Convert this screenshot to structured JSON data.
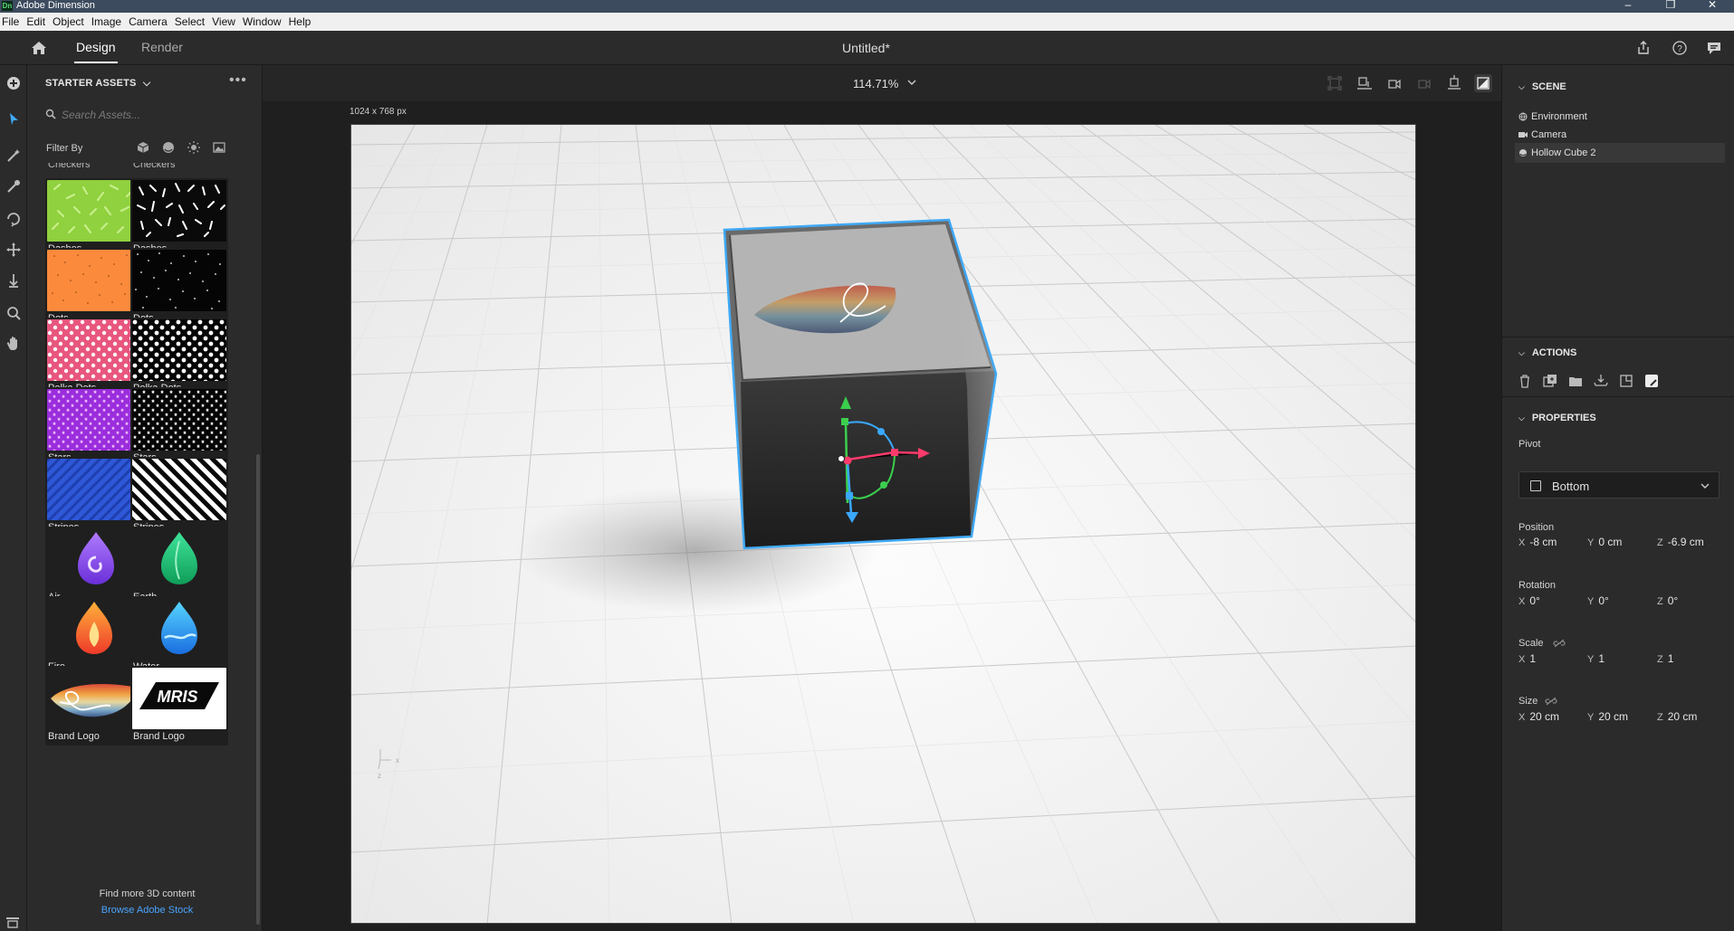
{
  "window": {
    "title": "Adobe Dimension",
    "app_badge": "Dn"
  },
  "menu": [
    "File",
    "Edit",
    "Object",
    "Image",
    "Camera",
    "Select",
    "View",
    "Window",
    "Help"
  ],
  "header": {
    "tabs": [
      "Design",
      "Render"
    ],
    "active_tab": "Design",
    "document_title": "Untitled*"
  },
  "assets": {
    "title": "STARTER ASSETS",
    "search_placeholder": "Search Assets...",
    "filter_label": "Filter By",
    "partial_top_labels": [
      "Checkers",
      "Checkers"
    ],
    "items": [
      {
        "label": "Dashes",
        "kind": "dashes-green"
      },
      {
        "label": "Dashes",
        "kind": "dashes-black"
      },
      {
        "label": "Dots",
        "kind": "dots-orange"
      },
      {
        "label": "Dots",
        "kind": "dots-black"
      },
      {
        "label": "Polka Dots",
        "kind": "polka-pink"
      },
      {
        "label": "Polka Dots",
        "kind": "polka-black"
      },
      {
        "label": "Stars",
        "kind": "stars-purple"
      },
      {
        "label": "Stars",
        "kind": "stars-black"
      },
      {
        "label": "Stripes",
        "kind": "stripes-blue"
      },
      {
        "label": "Stripes",
        "kind": "stripes-bw"
      },
      {
        "label": "Air",
        "kind": "drop-air"
      },
      {
        "label": "Earth",
        "kind": "drop-earth"
      },
      {
        "label": "Fire",
        "kind": "drop-fire"
      },
      {
        "label": "Water",
        "kind": "drop-water"
      },
      {
        "label": "Brand Logo",
        "kind": "logo-feather"
      },
      {
        "label": "Brand Logo",
        "kind": "logo-mris"
      }
    ],
    "mris_text": "MRIS",
    "find_more": "Find more 3D content",
    "browse_link": "Browse Adobe Stock"
  },
  "canvas": {
    "zoom": "114.71%",
    "dimensions": "1024 x 768 px",
    "axis_x": "x",
    "axis_z": "z"
  },
  "scene": {
    "title": "SCENE",
    "items": [
      {
        "label": "Environment",
        "icon": "globe-icon"
      },
      {
        "label": "Camera",
        "icon": "camera-icon"
      },
      {
        "label": "Hollow Cube 2",
        "icon": "object-icon",
        "selected": true
      }
    ]
  },
  "actions": {
    "title": "ACTIONS"
  },
  "properties": {
    "title": "PROPERTIES",
    "pivot_label": "Pivot",
    "pivot_value": "Bottom",
    "position_label": "Position",
    "position": {
      "x": "-8 cm",
      "y": "0 cm",
      "z": "-6.9 cm"
    },
    "rotation_label": "Rotation",
    "rotation": {
      "x": "0°",
      "y": "0°",
      "z": "0°"
    },
    "scale_label": "Scale",
    "scale": {
      "x": "1",
      "y": "1",
      "z": "1"
    },
    "size_label": "Size",
    "size": {
      "x": "20 cm",
      "y": "20 cm",
      "z": "20 cm"
    }
  },
  "colors": {
    "accent_blue": "#4aa3ff",
    "selection_outline": "#3fa9f5",
    "gizmo_green": "#3ccf4e",
    "gizmo_red": "#ff3b6b",
    "gizmo_blue": "#3aa8ff"
  }
}
